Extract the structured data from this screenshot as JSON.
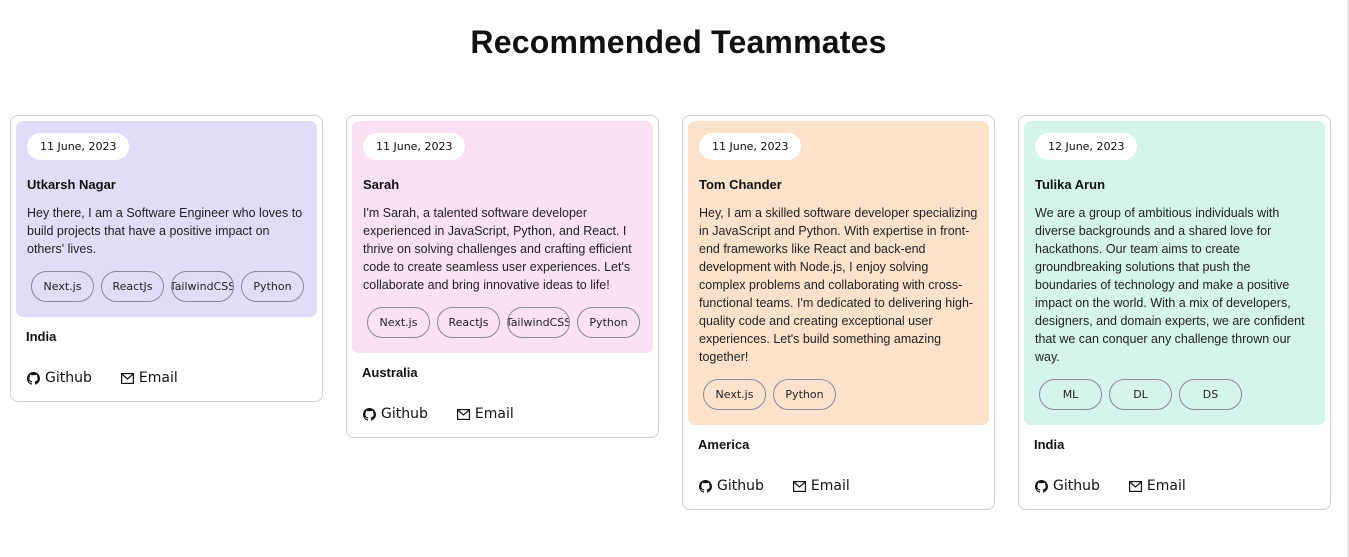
{
  "page": {
    "title": "Recommended Teammates"
  },
  "colors": {
    "lavender": "#e2dcf9",
    "pink": "#fae1f3",
    "peach": "#fde2cb",
    "mint": "#d5f5ec"
  },
  "cards": [
    {
      "date": "11 June, 2023",
      "name": "Utkarsh Nagar",
      "bio": "Hey there, I am a Software Engineer who loves to build projects that have a positive impact on others' lives.",
      "tags": [
        "Next.js",
        "ReactJs",
        "TailwindCSS",
        "Python"
      ],
      "location": "India",
      "github_label": "Github",
      "email_label": "Email"
    },
    {
      "date": "11 June, 2023",
      "name": "Sarah",
      "bio": "I'm Sarah, a talented software developer experienced in JavaScript, Python, and React. I thrive on solving challenges and crafting efficient code to create seamless user experiences. Let's collaborate and bring innovative ideas to life!",
      "tags": [
        "Next.js",
        "ReactJs",
        "TailwindCSS",
        "Python"
      ],
      "location": "Australia",
      "github_label": "Github",
      "email_label": "Email"
    },
    {
      "date": "11 June, 2023",
      "name": "Tom Chander",
      "bio": "Hey, I am a skilled software developer specializing in JavaScript and Python. With expertise in front-end frameworks like React and back-end development with Node.js, I enjoy solving complex problems and collaborating with cross-functional teams. I'm dedicated to delivering high-quality code and creating exceptional user experiences. Let's build something amazing together!",
      "tags": [
        "Next.js",
        "Python"
      ],
      "location": "America",
      "github_label": "Github",
      "email_label": "Email"
    },
    {
      "date": "12 June, 2023",
      "name": "Tulika Arun",
      "bio": "We are a group of ambitious individuals with diverse backgrounds and a shared love for hackathons. Our team aims to create groundbreaking solutions that push the boundaries of technology and make a positive impact on the world. With a mix of developers, designers, and domain experts, we are confident that we can conquer any challenge thrown our way.",
      "tags": [
        "ML",
        "DL",
        "DS"
      ],
      "location": "India",
      "github_label": "Github",
      "email_label": "Email"
    }
  ]
}
